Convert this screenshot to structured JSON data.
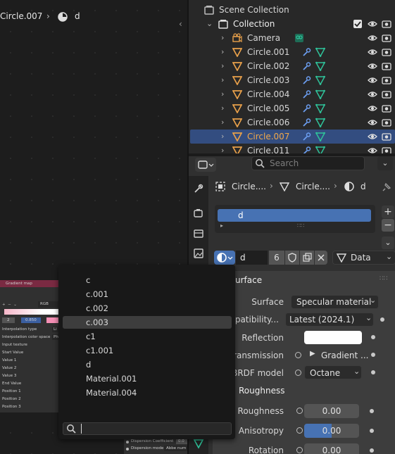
{
  "node_editor": {
    "breadcrumb_object": "Circle.007",
    "breadcrumb_material": "d",
    "gradient_node": {
      "title": "Gradient map",
      "mode": "RGB",
      "interp_btn": "Li",
      "interp_color_btn": "Ph",
      "stop_index": "2",
      "stop_pos": "0.850",
      "labels": [
        "Interpolation type",
        "Interpolation color space",
        "Input texture",
        "Start Value",
        "Value 1",
        "Value 2",
        "Value 3",
        "End Value",
        "Position 1",
        "Position 2",
        "Position 3"
      ]
    },
    "bottom_sockets": [
      {
        "label": "Dispersion Coefficient",
        "value": "0.0"
      },
      {
        "label": "Dispersion mode",
        "value": "Abbe num"
      }
    ]
  },
  "outliner": {
    "scene_collection": "Scene Collection",
    "collection": "Collection",
    "items": [
      "Camera",
      "Circle.001",
      "Circle.002",
      "Circle.003",
      "Circle.004",
      "Circle.005",
      "Circle.006",
      "Circle.007",
      "Circle.011"
    ]
  },
  "properties": {
    "search_placeholder": "Search",
    "breadcrumb": [
      "Circle....",
      "Circle....",
      "d"
    ],
    "slot_name": "d",
    "material_name": "d",
    "user_count": "6",
    "link_mode": "Data",
    "panel_title": "urface",
    "rows": [
      {
        "label": "Surface",
        "value": "Specular material"
      },
      {
        "label": "mpatibility...",
        "value": "Latest (2024.1)"
      },
      {
        "label": "Reflection",
        "value": ""
      },
      {
        "label": "Transmission",
        "value": "Gradient ..."
      },
      {
        "label": "BRDF model",
        "value": "Octane"
      }
    ],
    "roughness_section": "Roughness",
    "sliders": [
      {
        "label": "Roughness",
        "value": "0.00",
        "fill": 0
      },
      {
        "label": "Anisotropy",
        "value": "0.00",
        "fill": 0.5
      },
      {
        "label": "Rotation",
        "value": "0.00",
        "fill": 0
      }
    ]
  },
  "popup": {
    "items": [
      "c",
      "c.001",
      "c.002",
      "c.003",
      "c1",
      "c1.001",
      "d",
      "Material.001",
      "Material.004"
    ],
    "highlighted": "c.003",
    "search_value": ""
  },
  "colors": {
    "selection": "#334d80",
    "accent_blue": "#4772b3",
    "orange": "#e8a04a",
    "green": "#2fc39a"
  }
}
